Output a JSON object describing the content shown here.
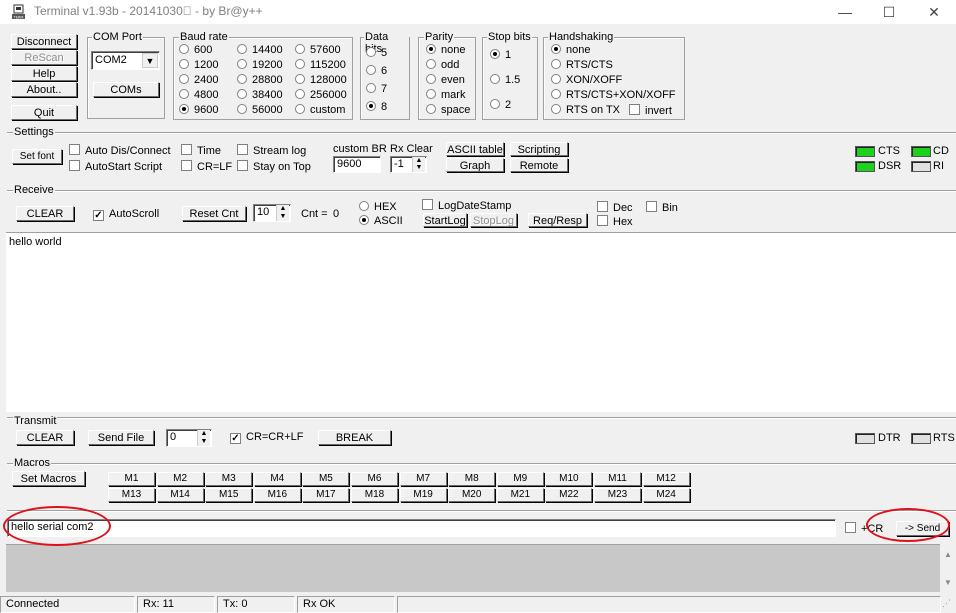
{
  "window": {
    "title": "Terminal v1.93b - 20141030\u0000 - by Br@y++",
    "minimize_glyph": "—",
    "maximize_glyph": "☐",
    "close_glyph": "✕",
    "app_icon": "terminal-app-icon"
  },
  "connection": {
    "disconnect": "Disconnect",
    "rescan": "ReScan",
    "help": "Help",
    "about": "About..",
    "quit": "Quit"
  },
  "com_port": {
    "label": "COM Port",
    "value": "COM2",
    "coms_button": "COMs"
  },
  "baud_rate": {
    "label": "Baud rate",
    "options": [
      "600",
      "1200",
      "2400",
      "4800",
      "9600",
      "14400",
      "19200",
      "28800",
      "38400",
      "56000",
      "57600",
      "115200",
      "128000",
      "256000",
      "custom"
    ],
    "selected": "9600"
  },
  "data_bits": {
    "label": "Data bits",
    "options": [
      "5",
      "6",
      "7",
      "8"
    ],
    "selected": "8"
  },
  "parity": {
    "label": "Parity",
    "options": [
      "none",
      "odd",
      "even",
      "mark",
      "space"
    ],
    "selected": "none"
  },
  "stop_bits": {
    "label": "Stop bits",
    "options": [
      "1",
      "1.5",
      "2"
    ],
    "selected": "1"
  },
  "handshaking": {
    "label": "Handshaking",
    "options": [
      "none",
      "RTS/CTS",
      "XON/XOFF",
      "RTS/CTS+XON/XOFF",
      "RTS on TX"
    ],
    "selected": "none",
    "invert_label": "invert"
  },
  "settings": {
    "label": "Settings",
    "set_font": "Set font",
    "auto_dis_connect": "Auto Dis/Connect",
    "autostart_script": "AutoStart Script",
    "time": "Time",
    "cr_lf": "CR=LF",
    "stream_log": "Stream log",
    "stay_on_top": "Stay on Top",
    "custom_br_label": "custom BR",
    "custom_br_value": "9600",
    "rx_clear_label": "Rx Clear",
    "rx_clear_value": "-1",
    "ascii_table": "ASCII table",
    "graph": "Graph",
    "scripting": "Scripting",
    "remote": "Remote"
  },
  "indicators": {
    "cts": "CTS",
    "cd": "CD",
    "dsr": "DSR",
    "ri": "RI",
    "dtr": "DTR",
    "rts": "RTS",
    "on_color": "#1fd11f",
    "off_color": "#e0e0e0"
  },
  "receive": {
    "label": "Receive",
    "clear": "CLEAR",
    "autoscroll": "AutoScroll",
    "reset_cnt": "Reset Cnt",
    "cnt_spin_value": "10",
    "cnt_label": "Cnt =",
    "cnt_value": "0",
    "hex": "HEX",
    "ascii": "ASCII",
    "log_date_stamp": "LogDateStamp",
    "start_log": "StartLog",
    "stop_log": "StopLog",
    "req_resp": "Req/Resp",
    "dec": "Dec",
    "hex_chk": "Hex",
    "content": "hello world"
  },
  "transmit": {
    "label": "Transmit",
    "clear": "CLEAR",
    "send_file": "Send File",
    "spin_value": "0",
    "cr_crlf": "CR=CR+LF",
    "break": "BREAK"
  },
  "macros": {
    "label": "Macros",
    "set_macros": "Set Macros",
    "row1": [
      "M1",
      "M2",
      "M3",
      "M4",
      "M5",
      "M6",
      "M7",
      "M8",
      "M9",
      "M10",
      "M11",
      "M12"
    ],
    "row2": [
      "M13",
      "M14",
      "M15",
      "M16",
      "M17",
      "M18",
      "M19",
      "M20",
      "M21",
      "M22",
      "M23",
      "M24"
    ]
  },
  "send": {
    "input_value": "hello serial com2",
    "cr_label": "+CR",
    "send_button": "-> Send"
  },
  "status": {
    "state": "Connected",
    "rx": "Rx: 11",
    "tx": "Tx: 0",
    "rx_ok": "Rx OK"
  },
  "annotation_color": "#e0101a"
}
